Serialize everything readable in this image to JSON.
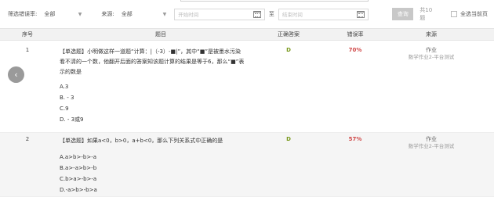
{
  "filters": {
    "error_rate_label": "筛选错误率:",
    "error_rate_value": "全部",
    "source_label": "来源:",
    "source_value": "全部",
    "start_placeholder": "开始时间",
    "to_label": "至",
    "end_placeholder": "结束时间",
    "query_button": "查询",
    "count_text": "共10题",
    "select_all_label": "全选当前页"
  },
  "table": {
    "headers": {
      "seq": "序号",
      "question": "题目",
      "correct": "正确答案",
      "error_rate": "错误率",
      "source": "来源"
    },
    "rows": [
      {
        "seq": "1",
        "question_line1": "【单选题】小明做这样一道题“计算：|（-3）-■|”，其中“■”是被墨水污染",
        "question_line2": "看不清的一个数，他翻开后面的答案知该题计算的结果是等于6，那么“■”表",
        "question_line3": "示的数是",
        "options": [
          "A.3",
          "B. - 3",
          "C.9",
          "D. - 3或9"
        ],
        "correct": "D",
        "error_rate": "70%",
        "source_main": "作业",
        "source_sub": "数学作业2-平台测试"
      },
      {
        "seq": "2",
        "question_line1": "【单选题】如果a<0，b>0，a+b<0，那么下列关系式中正确的是",
        "options": [
          "A.a>b>-b>-a",
          "B.a>-a>b>-b",
          "C.b>a>-b>-a",
          "D.-a>b>-b>a"
        ],
        "correct": "D",
        "error_rate": "57%",
        "source_main": "作业",
        "source_sub": "数学作业2-平台测试"
      }
    ]
  },
  "icons": {
    "select_caret": "caret-down-icon",
    "calendar": "calendar-icon",
    "prev_nav": "chevron-left-icon"
  },
  "colors": {
    "correct_answer": "#7a9a1e",
    "error_rate": "#d04848",
    "header_bg": "#f2f2f2",
    "query_button_bg": "#c8c8c8"
  }
}
